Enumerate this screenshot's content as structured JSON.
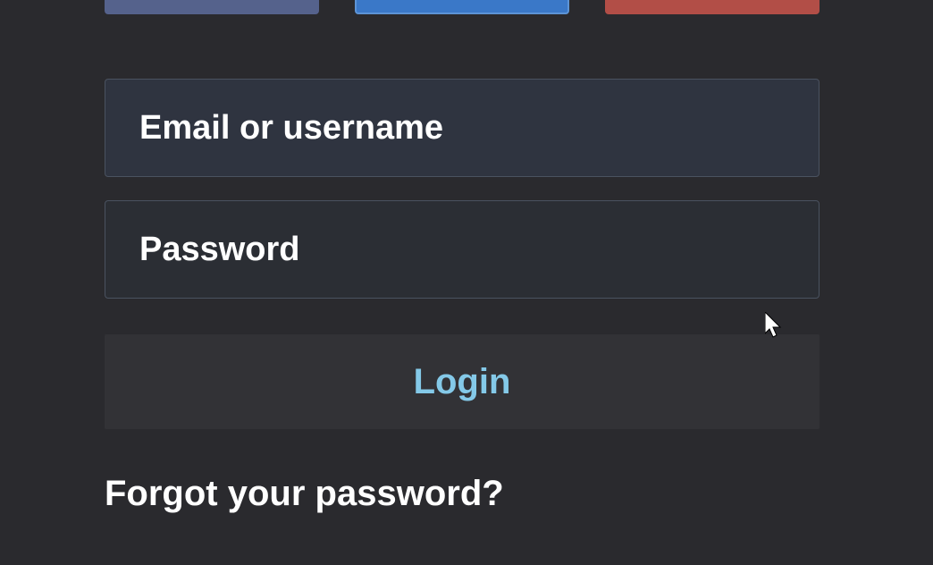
{
  "social": {
    "colors": {
      "a": "#55628c",
      "b": "#3a78c8",
      "c": "#b24e47"
    }
  },
  "form": {
    "username_placeholder": "Email or username",
    "password_placeholder": "Password",
    "login_label": "Login",
    "forgot_label": "Forgot your password?"
  }
}
